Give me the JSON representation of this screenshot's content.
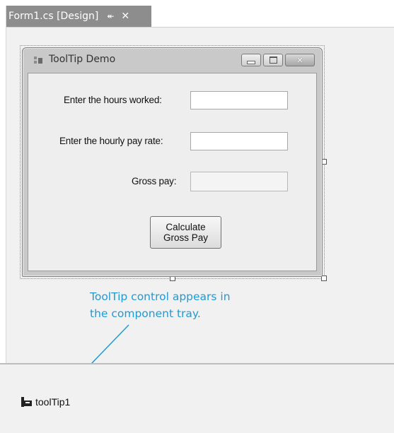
{
  "tab": {
    "title": "Form1.cs [Design]",
    "pin_icon": "pin-icon",
    "close_icon": "close-icon"
  },
  "form": {
    "title": "ToolTip Demo",
    "icon": "form-icon",
    "labels": {
      "hours": "Enter the hours worked:",
      "rate": "Enter the hourly pay rate:",
      "gross": "Gross pay:"
    },
    "inputs": {
      "hours_value": "",
      "rate_value": "",
      "gross_value": ""
    },
    "calc_button": {
      "line1": "Calculate",
      "line2": "Gross Pay"
    }
  },
  "annotation": {
    "line1": "ToolTip control appears in",
    "line2": "the component tray.",
    "color": "#1e9ad6"
  },
  "tray": {
    "items": [
      {
        "label": "toolTip1",
        "icon": "tooltip-component-icon"
      }
    ]
  }
}
